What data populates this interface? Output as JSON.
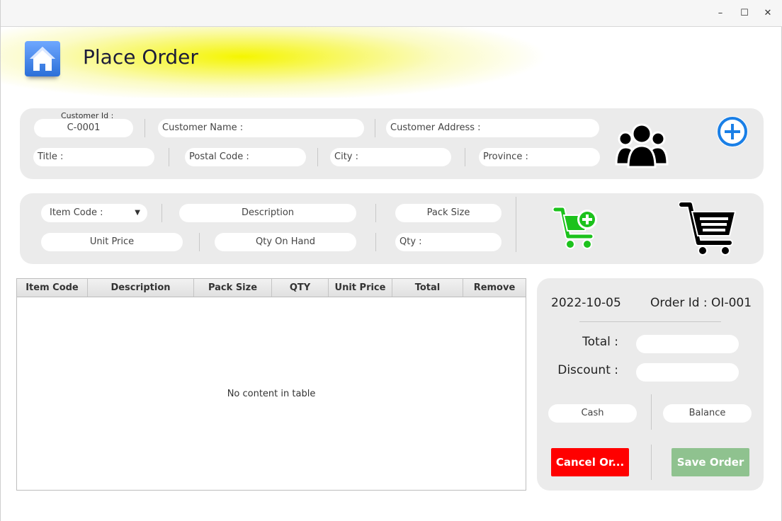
{
  "window": {
    "controls": {
      "minimize": "–",
      "maximize": "☐",
      "close": "✕"
    }
  },
  "header": {
    "title": "Place Order",
    "icon": "home-icon"
  },
  "customer": {
    "id_label": "Customer Id :",
    "id_value": "C-0001",
    "name_placeholder": "Customer Name :",
    "address_placeholder": "Customer Address :",
    "title_placeholder": "Title :",
    "postal_placeholder": "Postal Code :",
    "city_placeholder": "City :",
    "province_placeholder": "Province :",
    "customers_icon": "users-icon",
    "add_icon": "plus-circle-icon"
  },
  "item": {
    "code_placeholder": "Item Code :",
    "description_placeholder": "Description",
    "pack_size_placeholder": "Pack Size",
    "unit_price_placeholder": "Unit Price",
    "qty_on_hand_placeholder": "Qty On Hand",
    "qty_placeholder": "Qty :",
    "add_to_cart_icon": "cart-plus-icon",
    "cart_icon": "shopping-cart-icon"
  },
  "table": {
    "columns": [
      "Item Code",
      "Description",
      "Pack Size",
      "QTY",
      "Unit Price",
      "Total",
      "Remove"
    ],
    "empty_text": "No content in table"
  },
  "summary": {
    "date": "2022-10-05",
    "order_id": "Order Id : OI-001",
    "total_label": "Total :",
    "discount_label": "Discount :",
    "cash_placeholder": "Cash",
    "balance_placeholder": "Balance",
    "cancel_label": "Cancel Or...",
    "save_label": "Save Order"
  },
  "colors": {
    "accent_yellow": "#f5f500",
    "cancel_red": "#ff0000",
    "save_green": "#8fc28f",
    "cart_green": "#1cc21c",
    "add_blue": "#1a7fe6"
  }
}
